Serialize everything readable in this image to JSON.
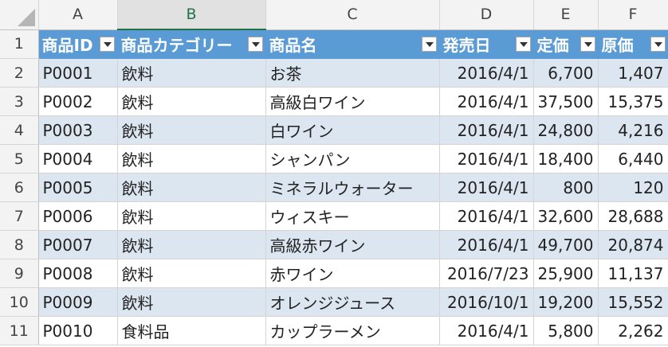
{
  "columns": [
    "A",
    "B",
    "C",
    "D",
    "E",
    "F"
  ],
  "selected_column": "B",
  "header": [
    "商品ID",
    "商品カテゴリー",
    "商品名",
    "発売日",
    "定価",
    "原価"
  ],
  "rows": [
    {
      "num": "1"
    },
    {
      "num": "2",
      "cells": [
        "P0001",
        "飲料",
        "お茶",
        "2016/4/1",
        "6,700",
        "1,407"
      ]
    },
    {
      "num": "3",
      "cells": [
        "P0002",
        "飲料",
        "高級白ワイン",
        "2016/4/1",
        "37,500",
        "15,375"
      ]
    },
    {
      "num": "4",
      "cells": [
        "P0003",
        "飲料",
        "白ワイン",
        "2016/4/1",
        "24,800",
        "4,216"
      ]
    },
    {
      "num": "5",
      "cells": [
        "P0004",
        "飲料",
        "シャンパン",
        "2016/4/1",
        "18,400",
        "6,440"
      ]
    },
    {
      "num": "6",
      "cells": [
        "P0005",
        "飲料",
        "ミネラルウォーター",
        "2016/4/1",
        "800",
        "120"
      ]
    },
    {
      "num": "7",
      "cells": [
        "P0006",
        "飲料",
        "ウィスキー",
        "2016/4/1",
        "32,600",
        "28,688"
      ]
    },
    {
      "num": "8",
      "cells": [
        "P0007",
        "飲料",
        "高級赤ワイン",
        "2016/4/1",
        "49,700",
        "20,874"
      ]
    },
    {
      "num": "9",
      "cells": [
        "P0008",
        "飲料",
        "赤ワイン",
        "2016/7/23",
        "25,900",
        "11,137"
      ]
    },
    {
      "num": "10",
      "cells": [
        "P0009",
        "飲料",
        "オレンジジュース",
        "2016/10/1",
        "19,200",
        "15,552"
      ]
    },
    {
      "num": "11",
      "cells": [
        "P0010",
        "食料品",
        "カップラーメン",
        "2016/4/1",
        "5,800",
        "2,262"
      ]
    }
  ],
  "icons": {
    "filter": "filter-dropdown-icon",
    "select_all": "select-all-triangle-icon"
  },
  "colors": {
    "header_fill": "#5b9bd5",
    "band_fill": "#dce6f1",
    "selected_col_accent": "#217346"
  }
}
